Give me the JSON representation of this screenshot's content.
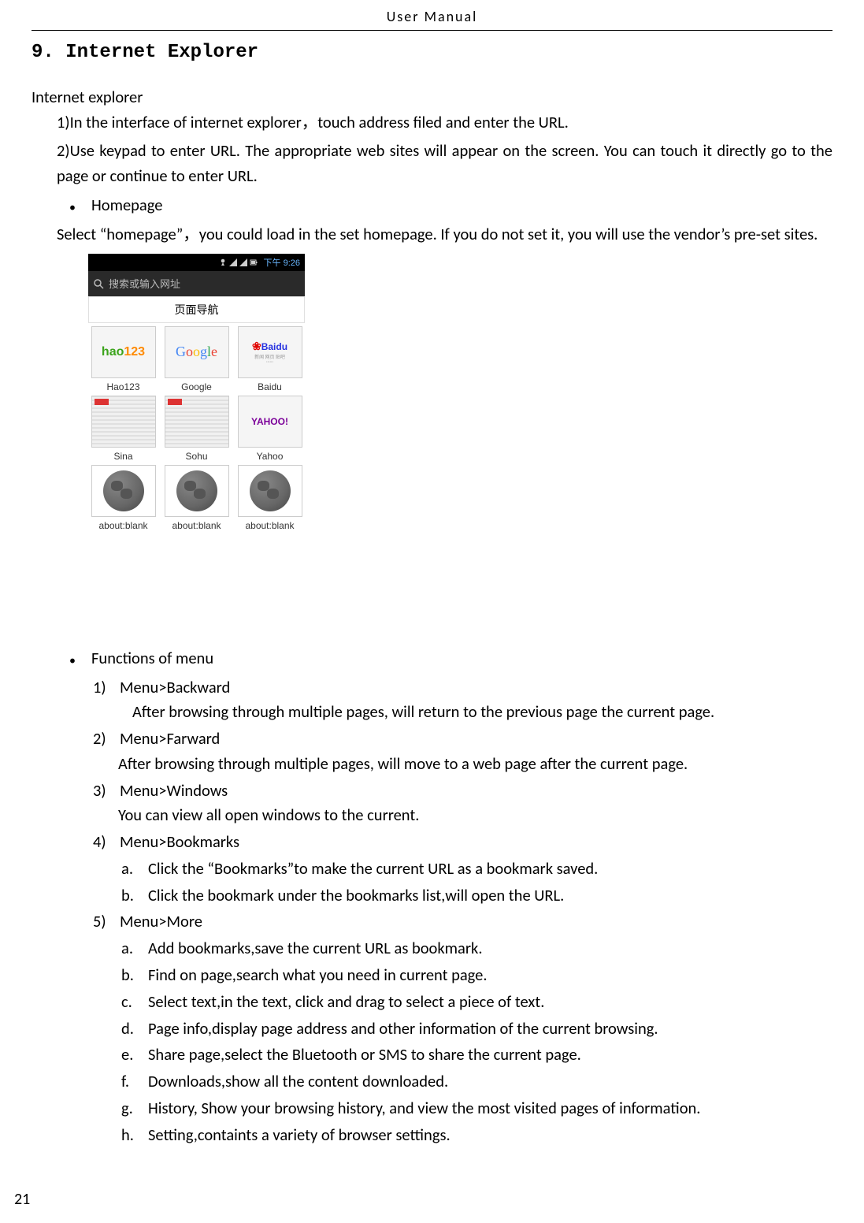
{
  "header": "User    Manual",
  "section_heading": "9. Internet Explorer",
  "intro_line": "Internet explorer",
  "para1": "1)In the interface of internet explorer，touch address filed and enter the URL.",
  "para2": "2)Use keypad to enter URL. The appropriate web sites will appear on the screen. You can touch it directly go to the page or continue to enter URL.",
  "bullet_homepage": "Homepage",
  "select_line": "Select  “homepage”，you could load in the set homepage. If you do not set it, you will use the vendor’s pre-set sites.",
  "screenshot": {
    "status_time": "下午 9:26",
    "address_placeholder": "搜索或输入网址",
    "nav_title": "页面导航",
    "thumbs": [
      "Hao123",
      "Google",
      "Baidu",
      "Sina",
      "Sohu",
      "Yahoo",
      "about:blank",
      "about:blank",
      "about:blank"
    ]
  },
  "bullet_functions": "Functions of menu",
  "menu": [
    {
      "n": "1)",
      "title": "Menu>Backward",
      "desc_style": "a",
      "desc": "After browsing through multiple pages, will return to the previous page the current page."
    },
    {
      "n": "2)",
      "title": "Menu>Farward",
      "desc_style": "b",
      "desc": "After browsing through multiple pages, will move to a web page after the current page."
    },
    {
      "n": "3)",
      "title": "Menu>Windows",
      "desc_style": "b",
      "desc": "You can view all open windows to the current."
    },
    {
      "n": "4)",
      "title": "Menu>Bookmarks",
      "subs": [
        {
          "l": "a.",
          "t": "Click the “Bookmarks”to make the current URL as a bookmark saved."
        },
        {
          "l": "b.",
          "t": "Click the bookmark under the bookmarks list,will open the URL."
        }
      ]
    },
    {
      "n": "5)",
      "title": "Menu>More",
      "subs": [
        {
          "l": "a.",
          "t": "Add bookmarks,save the current URL as bookmark."
        },
        {
          "l": "b.",
          "t": "Find on page,search what you need in current page."
        },
        {
          "l": "c.",
          "t": "Select text,in the text, click and drag to select a piece of text."
        },
        {
          "l": "d.",
          "t": "Page info,display page address and other information of the current browsing."
        },
        {
          "l": "e.",
          "t": "Share page,select the Bluetooth or SMS to share the current page."
        },
        {
          "l": "f.",
          "t": "Downloads,show all the content downloaded."
        },
        {
          "l": "g.",
          "t": "History, Show your browsing history, and view the most visited pages of information."
        },
        {
          "l": "h.",
          "t": "Setting,containts a variety of browser settings."
        }
      ]
    }
  ],
  "page_number": "21"
}
